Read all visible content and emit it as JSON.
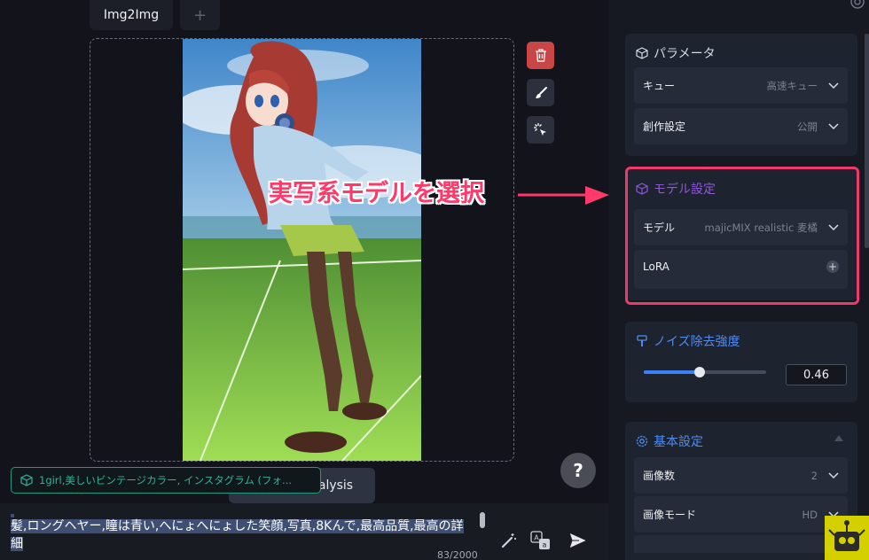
{
  "tabs": [
    {
      "label": "Img2Img"
    },
    {
      "label": "+"
    }
  ],
  "canvas": {
    "tools": [
      "trash-icon",
      "brush-icon",
      "magic-select-icon"
    ]
  },
  "analysis_button": {
    "label": "nalysis"
  },
  "tag_chip": {
    "text": "1girl,美しいビンテージカラー, インスタグラム (フォ..."
  },
  "prompt": {
    "line2": "髪,ロングヘヤー,瞳は青い,へにょへにょした笑顔,写真,8Kんで,最高品質,最高の詳",
    "line3": "細",
    "counter": "83/2000"
  },
  "help": {
    "label": "?"
  },
  "annotation": {
    "text": "実写系モデルを選択",
    "color": "#ff3a6b"
  },
  "panel": {
    "params": {
      "title": "パラメータ",
      "rows": [
        {
          "label": "キュー",
          "value": "高速キュー"
        },
        {
          "label": "創作設定",
          "value": "公開"
        }
      ]
    },
    "model": {
      "title": "モデル設定",
      "rows": [
        {
          "label": "モデル",
          "value": "majicMIX realistic 麦橘"
        },
        {
          "label": "LoRA",
          "value": "+"
        }
      ]
    },
    "noise": {
      "title": "ノイズ除去強度",
      "value": "0.46",
      "slider_fraction": 0.46
    },
    "basic": {
      "title": "基本設定",
      "rows": [
        {
          "label": "画像数",
          "value": "2"
        },
        {
          "label": "画像モード",
          "value": "HD"
        }
      ]
    }
  },
  "colors": {
    "accent": "#3b82f6",
    "model_title": "#8d58d8",
    "basic_title": "#4f8cf0",
    "tag_chip": "#2fb497",
    "delete": "#c94646",
    "annotation_box": "#ee3a6a"
  }
}
